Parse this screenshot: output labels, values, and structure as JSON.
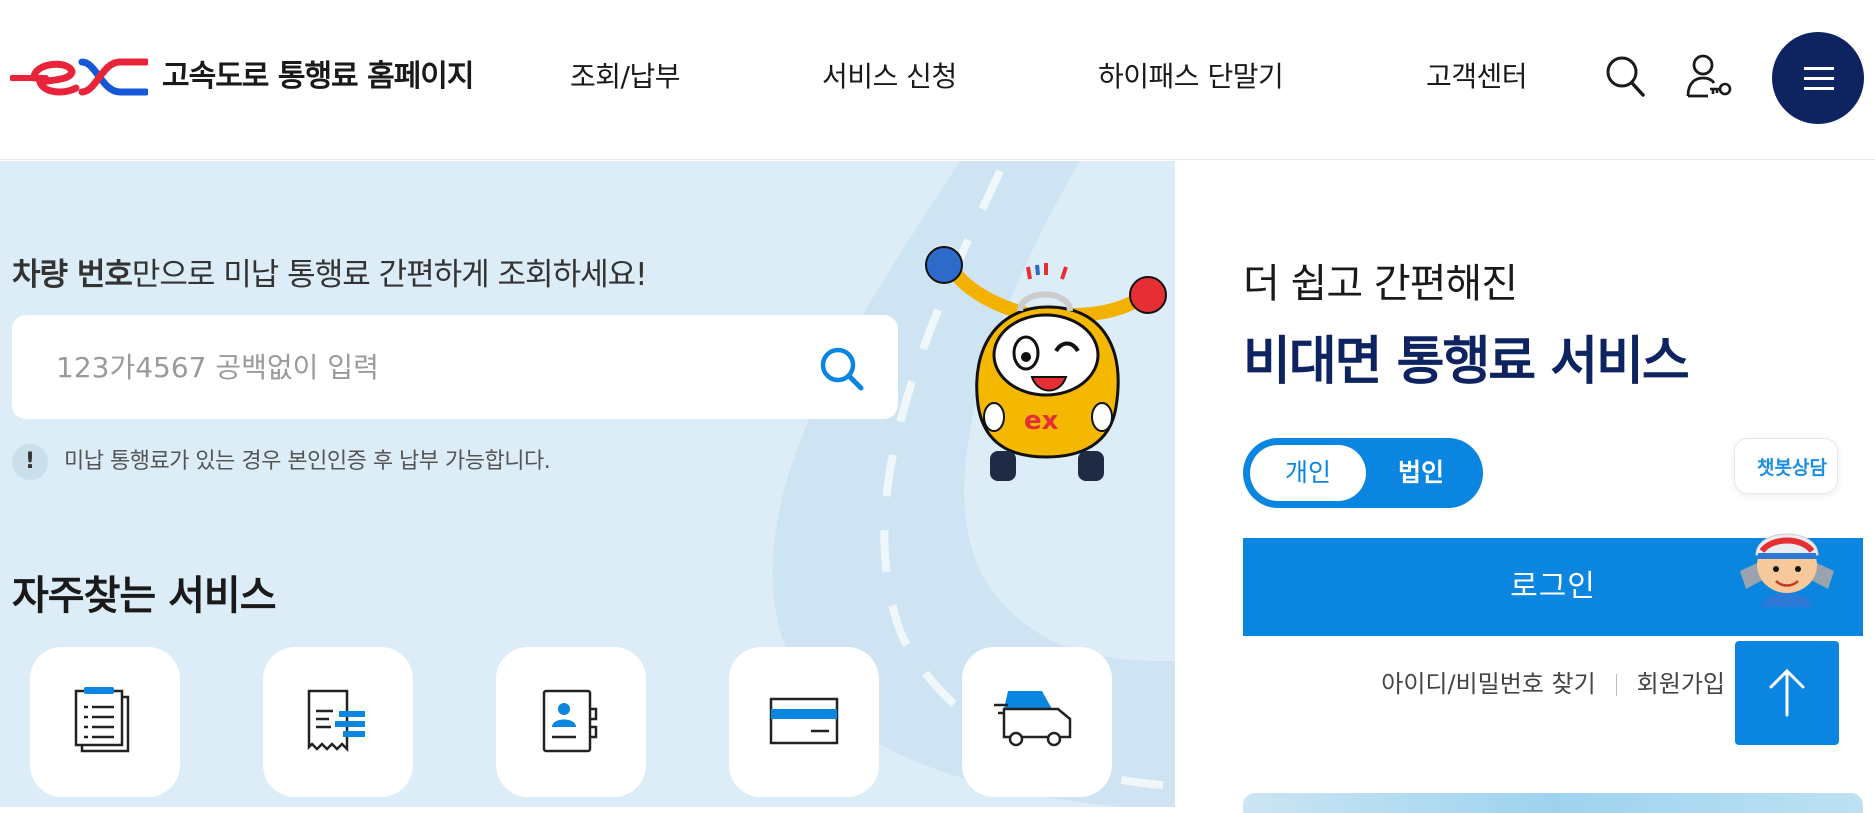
{
  "header": {
    "brand": "고속도로 통행료 홈페이지",
    "nav": [
      "조회/납부",
      "서비스 신청",
      "하이패스 단말기",
      "고객센터"
    ],
    "icons": [
      "search-icon",
      "user-key-icon",
      "hamburger-menu-icon"
    ]
  },
  "hero": {
    "promo_bold": "차량 번호",
    "promo_rest": "만으로 미납 통행료 간편하게 조회하세요!",
    "search_placeholder": "123가4567 공백없이 입력",
    "notice_icon": "!",
    "notice": "미납 통행료가 있는 경우 본인인증 후 납부 가능합니다."
  },
  "frequent": {
    "title": "자주찾는 서비스",
    "services": [
      {
        "icon": "document-list-icon"
      },
      {
        "icon": "receipt-icon"
      },
      {
        "icon": "id-card-icon"
      },
      {
        "icon": "credit-card-icon"
      },
      {
        "icon": "fast-car-icon"
      }
    ]
  },
  "right": {
    "subtitle": "더 쉽고 간편해진",
    "title": "비대면 통행료 서비스",
    "toggle": {
      "personal": "개인",
      "corporate": "법인"
    },
    "login": "로그인",
    "find_account": "아이디/비밀번호 찾기",
    "signup": "회원가입",
    "chatbot_label": "챗봇상담"
  },
  "colors": {
    "navy": "#0d2461",
    "blue": "#0a86e0",
    "hero_bg": "#dcedf7",
    "logo_red": "#e8233a"
  }
}
